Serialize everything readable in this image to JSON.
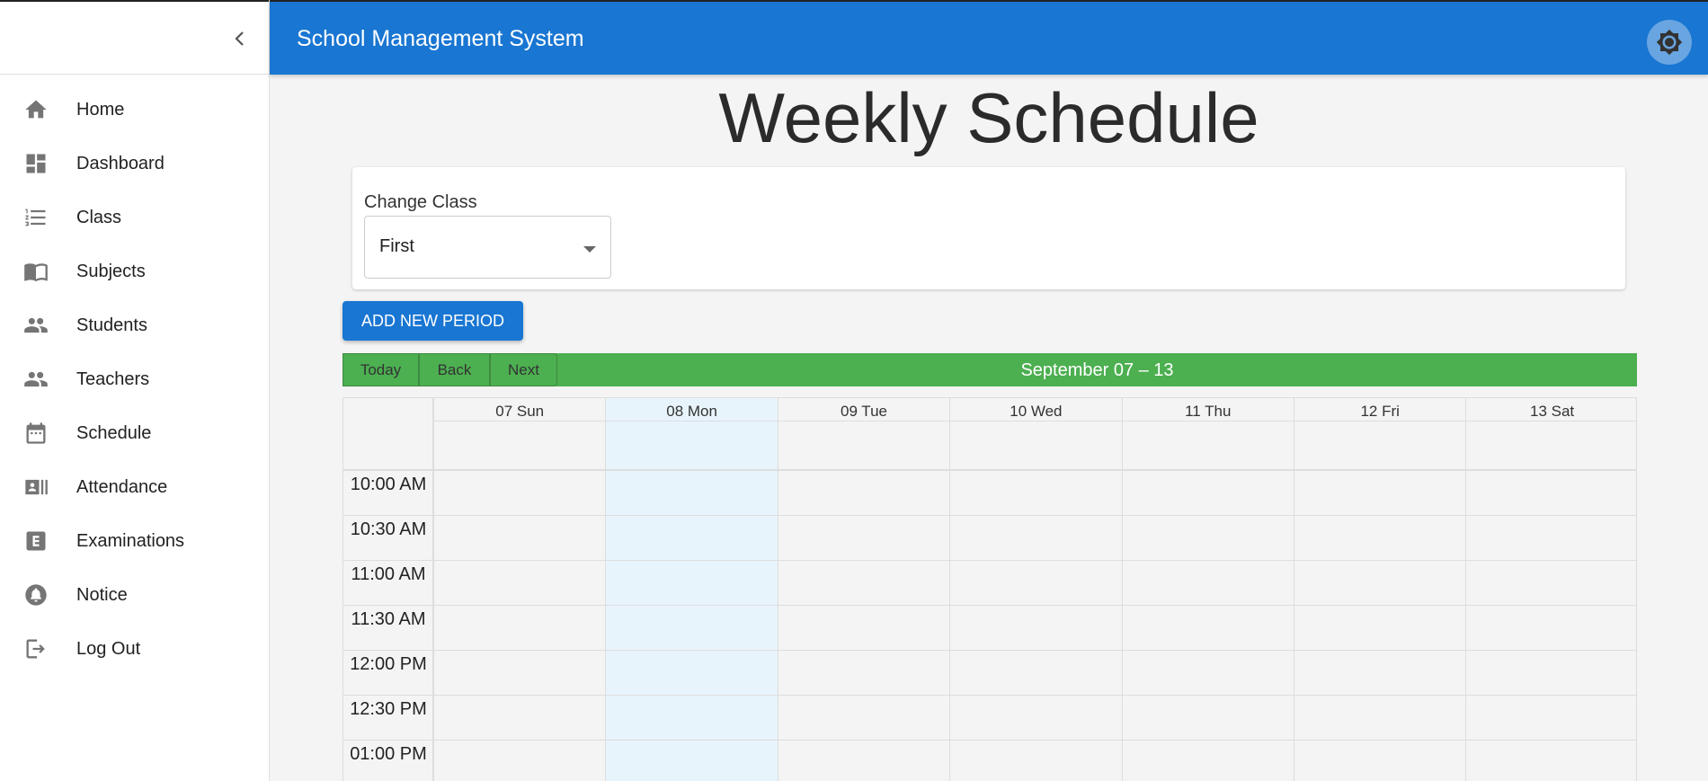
{
  "app": {
    "title": "School Management System"
  },
  "sidebar": {
    "items": [
      {
        "label": "Home",
        "icon": "home-icon"
      },
      {
        "label": "Dashboard",
        "icon": "dashboard-icon"
      },
      {
        "label": "Class",
        "icon": "list-icon"
      },
      {
        "label": "Subjects",
        "icon": "book-icon"
      },
      {
        "label": "Students",
        "icon": "people-icon"
      },
      {
        "label": "Teachers",
        "icon": "people-icon"
      },
      {
        "label": "Schedule",
        "icon": "calendar-icon"
      },
      {
        "label": "Attendance",
        "icon": "badge-icon"
      },
      {
        "label": "Examinations",
        "icon": "exam-icon"
      },
      {
        "label": "Notice",
        "icon": "bell-icon"
      },
      {
        "label": "Log Out",
        "icon": "logout-icon"
      }
    ]
  },
  "page": {
    "title": "Weekly Schedule"
  },
  "class_picker": {
    "label": "Change Class",
    "value": "First"
  },
  "actions": {
    "add_period": "ADD NEW PERIOD"
  },
  "calendar": {
    "toolbar": {
      "today": "Today",
      "back": "Back",
      "next": "Next",
      "range_label": "September 07 – 13"
    },
    "days": [
      "07 Sun",
      "08 Mon",
      "09 Tue",
      "10 Wed",
      "11 Thu",
      "12 Fri",
      "13 Sat"
    ],
    "highlighted_day": "08 Mon",
    "times": [
      "10:00 AM",
      "10:30 AM",
      "11:00 AM",
      "11:30 AM",
      "12:00 PM",
      "12:30 PM",
      "01:00 PM"
    ]
  },
  "colors": {
    "header": "#1976d2",
    "toolbar": "#4caf50",
    "today_column": "#e8f4fc"
  }
}
